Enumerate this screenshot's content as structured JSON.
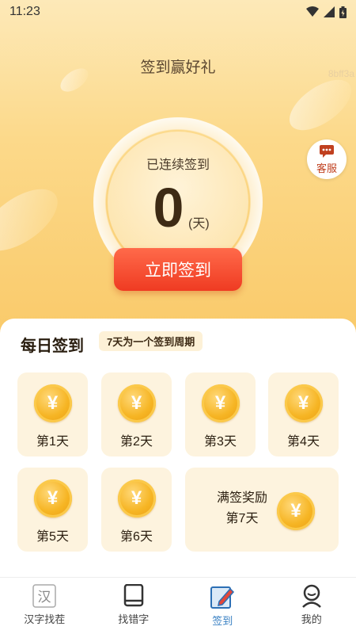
{
  "status_bar": {
    "time": "11:23",
    "icons": [
      "wifi-icon",
      "signal-icon",
      "battery-icon"
    ]
  },
  "header": {
    "title": "签到赢好礼",
    "watermark": "8bff3a"
  },
  "streak": {
    "label": "已连续签到",
    "count": "0",
    "unit": "(天)"
  },
  "service": {
    "label": "客服",
    "icon": "chat-bubble-icon"
  },
  "checkin_button": {
    "label": "立即签到"
  },
  "daily": {
    "title": "每日签到",
    "cycle_note": "7天为一个签到周期",
    "coin_symbol": "¥",
    "days": [
      {
        "label": "第1天"
      },
      {
        "label": "第2天"
      },
      {
        "label": "第3天"
      },
      {
        "label": "第4天"
      },
      {
        "label": "第5天"
      },
      {
        "label": "第6天"
      }
    ],
    "reward": {
      "line1": "满签奖励",
      "line2": "第7天"
    }
  },
  "tabs": [
    {
      "label": "汉字找茬",
      "icon": "han-character-icon",
      "active": false
    },
    {
      "label": "找错字",
      "icon": "book-icon",
      "active": false
    },
    {
      "label": "签到",
      "icon": "pencil-notebook-icon",
      "active": true
    },
    {
      "label": "我的",
      "icon": "user-icon",
      "active": false
    }
  ],
  "colors": {
    "accent": "#ef3b22",
    "tab_active": "#3b82c4",
    "coin": "#f6b524"
  }
}
